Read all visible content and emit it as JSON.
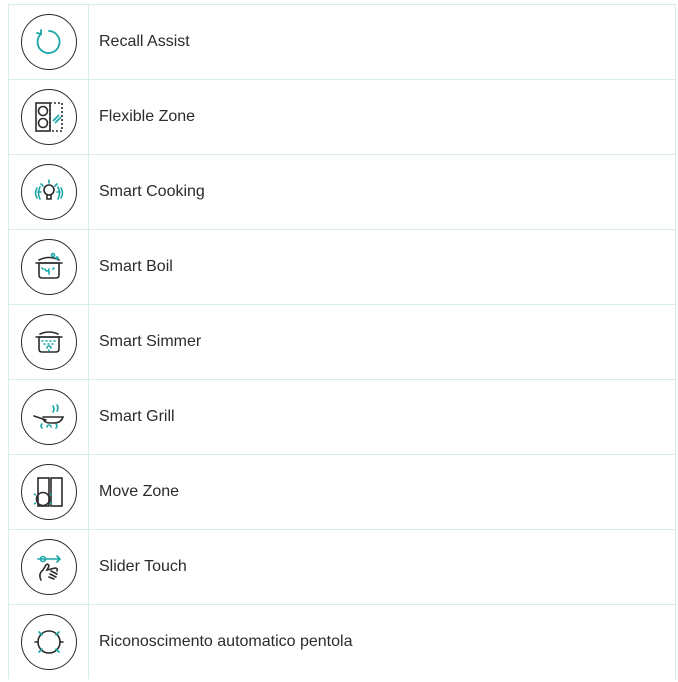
{
  "features": [
    {
      "label": "Recall Assist",
      "icon": "recall-icon"
    },
    {
      "label": "Flexible Zone",
      "icon": "flexible-zone-icon"
    },
    {
      "label": "Smart Cooking",
      "icon": "smart-cooking-icon"
    },
    {
      "label": "Smart Boil",
      "icon": "smart-boil-icon"
    },
    {
      "label": "Smart Simmer",
      "icon": "smart-simmer-icon"
    },
    {
      "label": "Smart Grill",
      "icon": "smart-grill-icon"
    },
    {
      "label": "Move Zone",
      "icon": "move-zone-icon"
    },
    {
      "label": "Slider Touch",
      "icon": "slider-touch-icon"
    },
    {
      "label": "Riconoscimento automatico pentola",
      "icon": "pot-detection-icon"
    }
  ],
  "colors": {
    "accent": "#1aa6a6",
    "border": "#d8ecec",
    "text": "#2b2b2b"
  }
}
